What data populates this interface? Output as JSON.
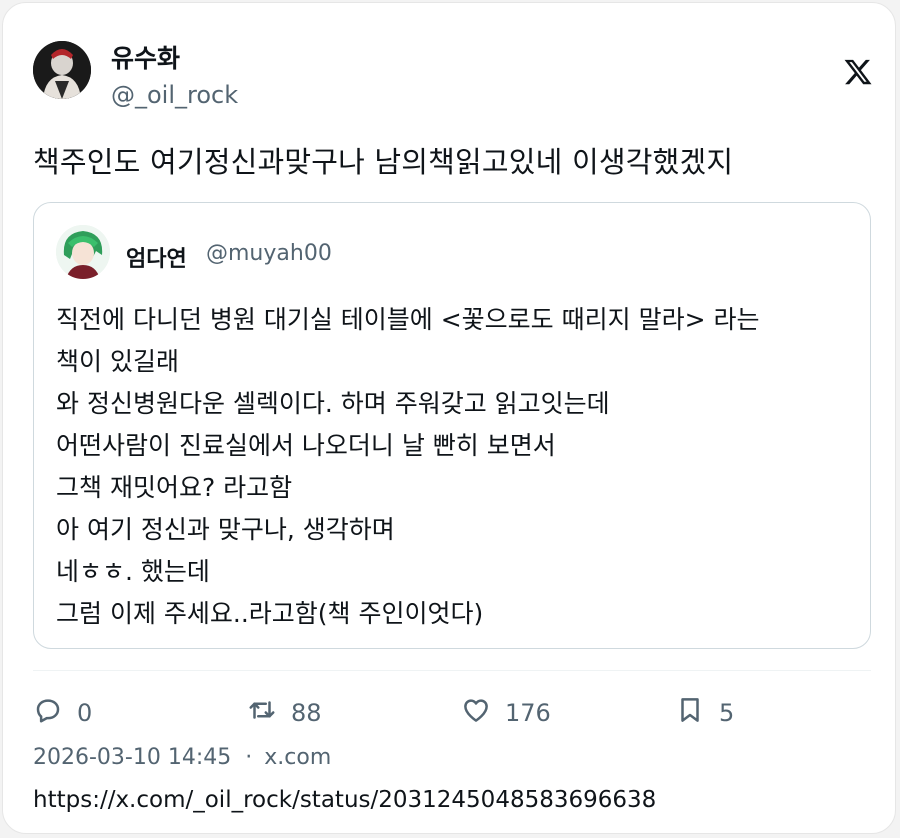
{
  "author": {
    "display_name": "유수화",
    "handle": "@_oil_rock"
  },
  "tweet": {
    "text": "책주인도 여기정신과맞구나 남의책읽고있네 이생각했겠지"
  },
  "quoted": {
    "display_name": "엄다연",
    "handle": "@muyah00",
    "lines": [
      "직전에 다니던 병원 대기실 테이블에 <꽃으로도 때리지 말라> 라는",
      "책이 있길래",
      "와 정신병원다운 셀렉이다. 하며 주워갖고 읽고잇는데",
      "어떤사람이 진료실에서 나오더니 날 빤히 보면서",
      "그책 재밋어요? 라고함",
      "아 여기 정신과 맞구나, 생각하며",
      "네ㅎㅎ. 했는데",
      "그럼 이제 주세요..라고함(책 주인이엇다)"
    ]
  },
  "actions": {
    "replies": "0",
    "retweets": "88",
    "likes": "176",
    "bookmarks": "5"
  },
  "meta": {
    "timestamp": "2026-03-10 14:45",
    "separator": "·",
    "source": "x.com",
    "url": "https://x.com/_oil_rock/status/2031245048583696638"
  },
  "icons": {
    "brand": "x-logo-icon",
    "reply": "reply-icon",
    "retweet": "retweet-icon",
    "like": "heart-icon",
    "bookmark": "bookmark-icon"
  },
  "colors": {
    "text": "#0f1419",
    "secondary": "#536471",
    "border": "#cfd9de"
  }
}
